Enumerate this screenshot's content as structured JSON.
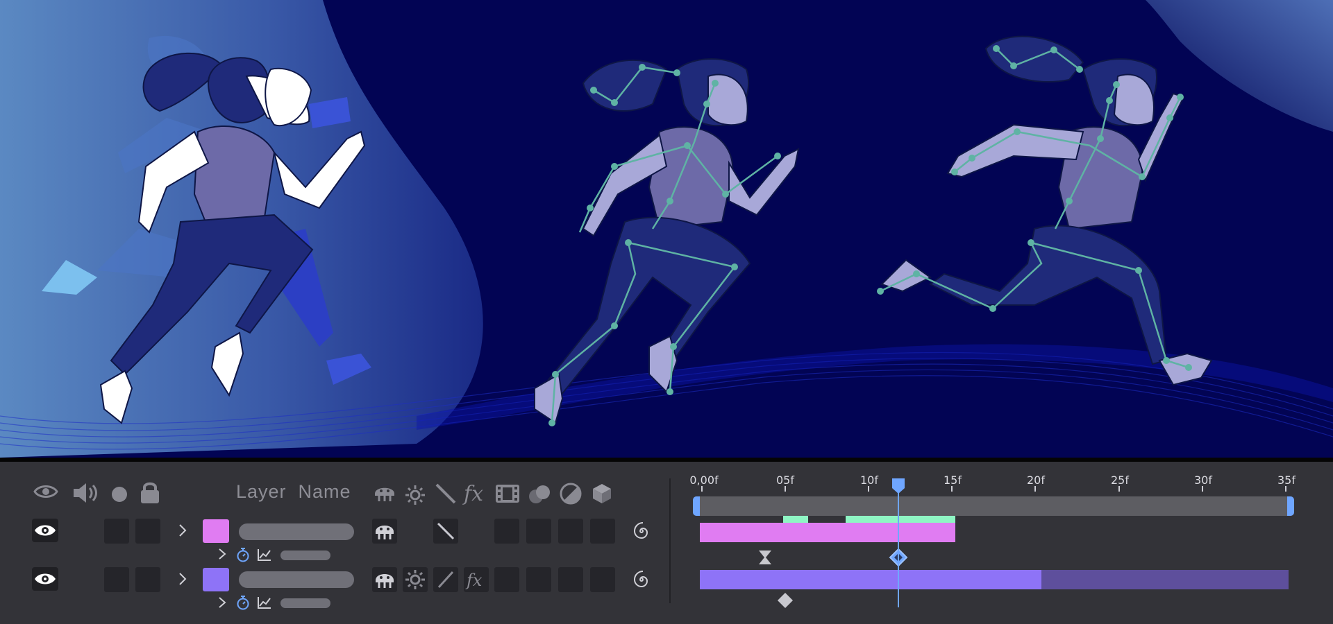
{
  "app": {
    "header": {
      "layer_name_label": "Layer  Name",
      "icons": [
        "eye-icon",
        "speaker-icon",
        "solo-dot-icon",
        "lock-icon",
        "shy-icon",
        "collapse-icon",
        "quality-icon",
        "fx-icon",
        "frame-blend-icon",
        "motion-blur-icon",
        "adjustment-icon",
        "3d-icon"
      ]
    },
    "layers": [
      {
        "color": "#e07cf2",
        "switches": [
          "shy-icon",
          "quality-icon"
        ],
        "has_effects": false
      },
      {
        "color": "#8e73f7",
        "switches": [
          "shy-icon",
          "collapse-icon",
          "quality-icon",
          "fx-icon"
        ],
        "has_effects": true
      }
    ],
    "timeline": {
      "ticks": [
        "0,00f",
        "05f",
        "10f",
        "15f",
        "20f",
        "25f",
        "30f",
        "35f"
      ],
      "current_frame": 12,
      "accent": "#6fa6ff",
      "work_area_color": "#5d5d62",
      "highlight_color": "#8ff5c4",
      "layer1_bar_color": "#e07cf2",
      "layer2_bar_color": "#8e73f7",
      "layer2_tail_color": "#5e4f9c"
    },
    "scene": {
      "background": "#020454",
      "gradient_left": "#5b89c2",
      "figure_light": "#ffffff",
      "figure_shade": "#1f2a7a",
      "bone_color": "#5fb3a4"
    }
  }
}
